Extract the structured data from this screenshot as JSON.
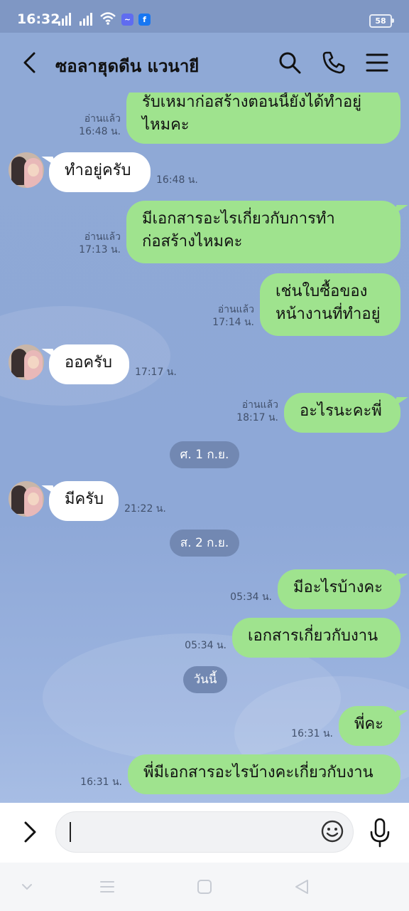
{
  "status": {
    "time": "16:32",
    "battery": "58"
  },
  "header": {
    "title": "ซอลาฮุดดีน แวนายี"
  },
  "messages": [
    {
      "dir": "out",
      "lines": [
        "รับเหมาก่อสร้างตอนนี้ยังได้ทำอยู่",
        "ไหมคะ"
      ],
      "read": "อ่านแล้ว",
      "time": "16:48 น."
    },
    {
      "dir": "in",
      "text": "ทำอยู่ครับ",
      "time": "16:48 น."
    },
    {
      "dir": "out",
      "lines": [
        "มีเอกสารอะไรเกี่ยวกับการทำ",
        "ก่อสร้างไหมคะ"
      ],
      "read": "อ่านแล้ว",
      "time": "17:13 น."
    },
    {
      "dir": "out",
      "lines": [
        "เช่นใบซื้อของ",
        "หน้างานที่ทำอยู่"
      ],
      "read": "อ่านแล้ว",
      "time": "17:14 น."
    },
    {
      "dir": "in",
      "text": "ออครับ",
      "time": "17:17 น."
    },
    {
      "dir": "out",
      "text": "อะไรนะคะพี่",
      "read": "อ่านแล้ว",
      "time": "18:17 น."
    },
    {
      "dir": "in",
      "text": "มีครับ",
      "time": "21:22 น."
    },
    {
      "dir": "out",
      "text": "มีอะไรบ้างคะ",
      "time": "05:34 น."
    },
    {
      "dir": "out",
      "text": "เอกสารเกี่ยวกับงาน",
      "time": "05:34 น."
    },
    {
      "dir": "out",
      "text": "พี่คะ",
      "time": "16:31 น."
    },
    {
      "dir": "out",
      "text": "พี่มีเอกสารอะไรบ้างคะเกี่ยวกับงาน",
      "time": "16:31 น."
    }
  ],
  "dates": [
    "ศ. 1 ก.ย.",
    "ส. 2 ก.ย.",
    "วันนี้"
  ],
  "input": {
    "value": ""
  }
}
